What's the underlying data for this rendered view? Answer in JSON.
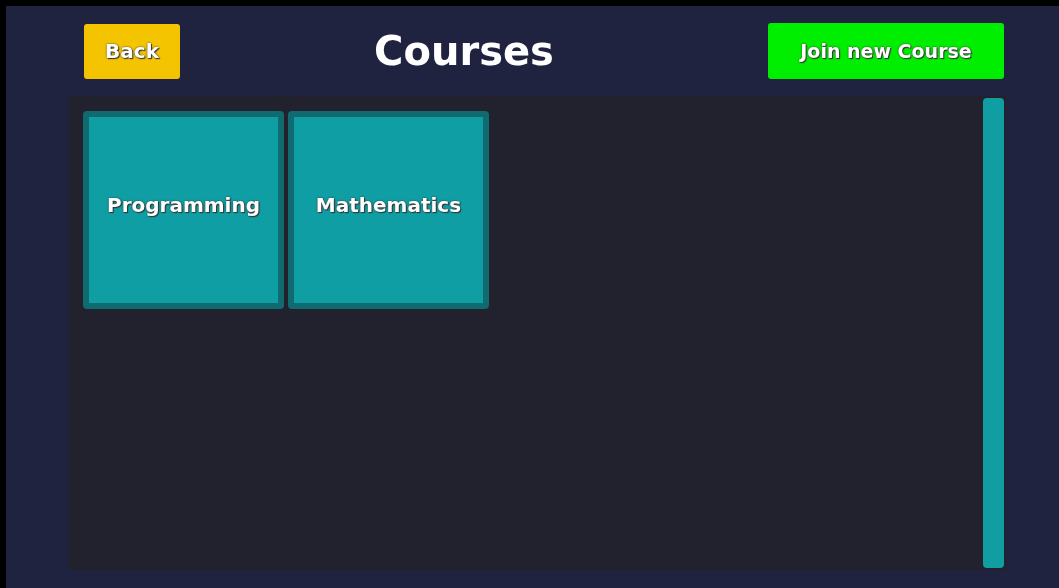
{
  "header": {
    "back_button": "Back",
    "title": "Courses",
    "join_button": "Join new Course"
  },
  "courses": [
    {
      "label": "Programming"
    },
    {
      "label": "Mathematics"
    }
  ]
}
